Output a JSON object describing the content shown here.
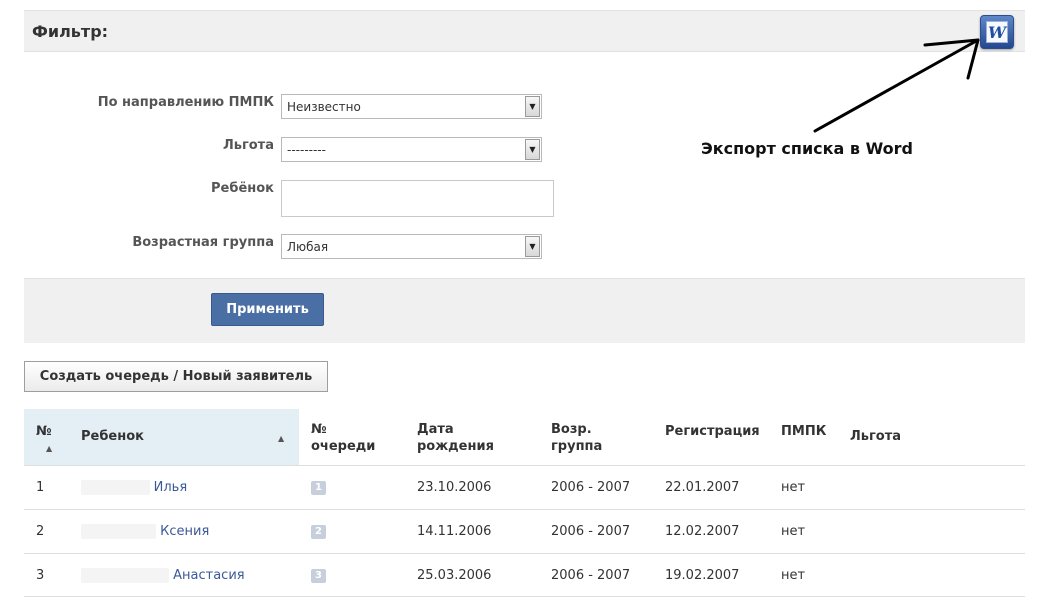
{
  "filter": {
    "title": "Фильтр:"
  },
  "export": {
    "icon": "word-icon",
    "letter": "W",
    "annotation": "Экспорт списка в Word"
  },
  "form": {
    "direction_label": "По направлению ПМПК",
    "direction_value": "Неизвестно",
    "benefit_label": "Льгота",
    "benefit_value": "---------",
    "child_label": "Ребёнок",
    "child_value": "",
    "age_label": "Возрастная группа",
    "age_value": "Любая"
  },
  "buttons": {
    "apply": "Применить",
    "create": "Создать очередь / Новый заявитель"
  },
  "table": {
    "headers": {
      "num": "№",
      "child": "Ребенок",
      "queue_1": "№",
      "queue_2": "очереди",
      "birth_1": "Дата",
      "birth_2": "рождения",
      "age_1": "Возр.",
      "age_2": "группа",
      "registration": "Регистрация",
      "pmpk": "ПМПК",
      "benefit": "Льгота"
    },
    "rows": [
      {
        "num": "1",
        "child": "Илья",
        "queue": "1",
        "birth": "23.10.2006",
        "age_group": "2006 - 2007",
        "registration": "22.01.2007",
        "pmpk": "нет",
        "benefit": ""
      },
      {
        "num": "2",
        "child": "Ксения",
        "queue": "2",
        "birth": "14.11.2006",
        "age_group": "2006 - 2007",
        "registration": "12.02.2007",
        "pmpk": "нет",
        "benefit": ""
      },
      {
        "num": "3",
        "child": "Анастасия",
        "queue": "3",
        "birth": "25.03.2006",
        "age_group": "2006 - 2007",
        "registration": "19.02.2007",
        "pmpk": "нет",
        "benefit": ""
      }
    ]
  },
  "colors": {
    "accent_button": "#4a6fa5",
    "panel_bg": "#f0f0f0",
    "sorted_header_bg": "#e3eef5",
    "link": "#3b5998"
  }
}
